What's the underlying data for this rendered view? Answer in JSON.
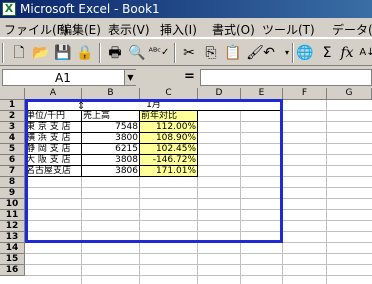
{
  "window": {
    "title": "Microsoft Excel - Book1",
    "app_icon": "X"
  },
  "menu": [
    "ファイル(F)",
    "編集(E)",
    "表示(V)",
    "挿入(I)",
    "書式(O)",
    "ツール(T)",
    "データ(D)"
  ],
  "toolbar": {
    "icons": [
      "new-file-icon",
      "open-folder-icon",
      "save-icon",
      "permission-icon",
      "print-icon",
      "print-preview-icon",
      "spell-check-icon",
      "cut-icon",
      "copy-icon",
      "paste-icon",
      "format-painter-icon",
      "undo-icon",
      "redo-icon",
      "hyperlink-icon",
      "autosum-icon",
      "function-icon",
      "sort-ascending-icon"
    ]
  },
  "formula_bar": {
    "cell_ref": "A1",
    "equals": "=",
    "content": ""
  },
  "columns": [
    "A",
    "B",
    "C",
    "D",
    "E",
    "F",
    "G"
  ],
  "rows": [
    "1",
    "2",
    "3",
    "4",
    "5",
    "6",
    "7",
    "8",
    "9",
    "10",
    "11",
    "12",
    "13",
    "14",
    "15",
    "16"
  ],
  "sheet": {
    "title": "1月",
    "headers": [
      "単位/千円",
      "売上高",
      "前年対比"
    ],
    "data": [
      {
        "branch": "東 京 支 店",
        "sales": "7548",
        "ratio": "112.00%"
      },
      {
        "branch": "横 浜 支 店",
        "sales": "3800",
        "ratio": "108.90%"
      },
      {
        "branch": "静 岡 支 店",
        "sales": "6215",
        "ratio": "102.45%"
      },
      {
        "branch": "大 阪 支 店",
        "sales": "3808",
        "ratio": "-146.72%"
      },
      {
        "branch": "名古屋支店",
        "sales": "3806",
        "ratio": "171.01%"
      }
    ]
  },
  "colors": {
    "title_start": "#0a246a",
    "title_end": "#3a6ea5",
    "selection": "#1f2ad6",
    "highlight": "#ffff99"
  }
}
